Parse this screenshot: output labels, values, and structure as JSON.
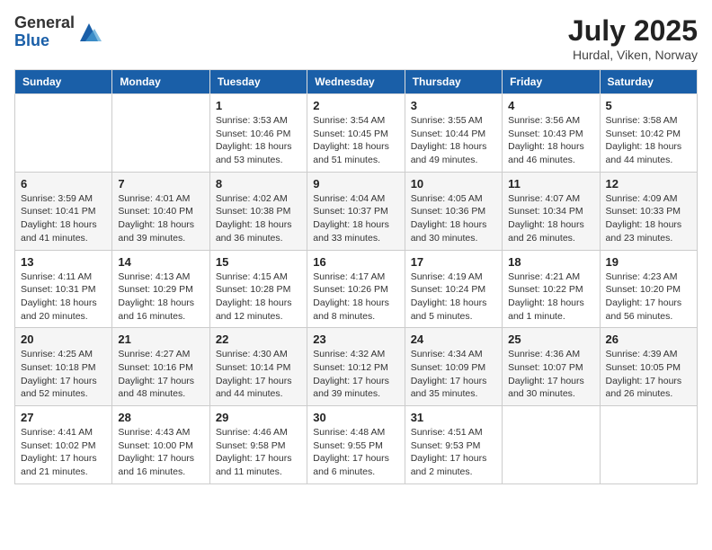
{
  "logo": {
    "general": "General",
    "blue": "Blue"
  },
  "header": {
    "month": "July 2025",
    "location": "Hurdal, Viken, Norway"
  },
  "weekdays": [
    "Sunday",
    "Monday",
    "Tuesday",
    "Wednesday",
    "Thursday",
    "Friday",
    "Saturday"
  ],
  "weeks": [
    [
      null,
      null,
      {
        "day": "1",
        "sunrise": "Sunrise: 3:53 AM",
        "sunset": "Sunset: 10:46 PM",
        "daylight": "Daylight: 18 hours and 53 minutes."
      },
      {
        "day": "2",
        "sunrise": "Sunrise: 3:54 AM",
        "sunset": "Sunset: 10:45 PM",
        "daylight": "Daylight: 18 hours and 51 minutes."
      },
      {
        "day": "3",
        "sunrise": "Sunrise: 3:55 AM",
        "sunset": "Sunset: 10:44 PM",
        "daylight": "Daylight: 18 hours and 49 minutes."
      },
      {
        "day": "4",
        "sunrise": "Sunrise: 3:56 AM",
        "sunset": "Sunset: 10:43 PM",
        "daylight": "Daylight: 18 hours and 46 minutes."
      },
      {
        "day": "5",
        "sunrise": "Sunrise: 3:58 AM",
        "sunset": "Sunset: 10:42 PM",
        "daylight": "Daylight: 18 hours and 44 minutes."
      }
    ],
    [
      {
        "day": "6",
        "sunrise": "Sunrise: 3:59 AM",
        "sunset": "Sunset: 10:41 PM",
        "daylight": "Daylight: 18 hours and 41 minutes."
      },
      {
        "day": "7",
        "sunrise": "Sunrise: 4:01 AM",
        "sunset": "Sunset: 10:40 PM",
        "daylight": "Daylight: 18 hours and 39 minutes."
      },
      {
        "day": "8",
        "sunrise": "Sunrise: 4:02 AM",
        "sunset": "Sunset: 10:38 PM",
        "daylight": "Daylight: 18 hours and 36 minutes."
      },
      {
        "day": "9",
        "sunrise": "Sunrise: 4:04 AM",
        "sunset": "Sunset: 10:37 PM",
        "daylight": "Daylight: 18 hours and 33 minutes."
      },
      {
        "day": "10",
        "sunrise": "Sunrise: 4:05 AM",
        "sunset": "Sunset: 10:36 PM",
        "daylight": "Daylight: 18 hours and 30 minutes."
      },
      {
        "day": "11",
        "sunrise": "Sunrise: 4:07 AM",
        "sunset": "Sunset: 10:34 PM",
        "daylight": "Daylight: 18 hours and 26 minutes."
      },
      {
        "day": "12",
        "sunrise": "Sunrise: 4:09 AM",
        "sunset": "Sunset: 10:33 PM",
        "daylight": "Daylight: 18 hours and 23 minutes."
      }
    ],
    [
      {
        "day": "13",
        "sunrise": "Sunrise: 4:11 AM",
        "sunset": "Sunset: 10:31 PM",
        "daylight": "Daylight: 18 hours and 20 minutes."
      },
      {
        "day": "14",
        "sunrise": "Sunrise: 4:13 AM",
        "sunset": "Sunset: 10:29 PM",
        "daylight": "Daylight: 18 hours and 16 minutes."
      },
      {
        "day": "15",
        "sunrise": "Sunrise: 4:15 AM",
        "sunset": "Sunset: 10:28 PM",
        "daylight": "Daylight: 18 hours and 12 minutes."
      },
      {
        "day": "16",
        "sunrise": "Sunrise: 4:17 AM",
        "sunset": "Sunset: 10:26 PM",
        "daylight": "Daylight: 18 hours and 8 minutes."
      },
      {
        "day": "17",
        "sunrise": "Sunrise: 4:19 AM",
        "sunset": "Sunset: 10:24 PM",
        "daylight": "Daylight: 18 hours and 5 minutes."
      },
      {
        "day": "18",
        "sunrise": "Sunrise: 4:21 AM",
        "sunset": "Sunset: 10:22 PM",
        "daylight": "Daylight: 18 hours and 1 minute."
      },
      {
        "day": "19",
        "sunrise": "Sunrise: 4:23 AM",
        "sunset": "Sunset: 10:20 PM",
        "daylight": "Daylight: 17 hours and 56 minutes."
      }
    ],
    [
      {
        "day": "20",
        "sunrise": "Sunrise: 4:25 AM",
        "sunset": "Sunset: 10:18 PM",
        "daylight": "Daylight: 17 hours and 52 minutes."
      },
      {
        "day": "21",
        "sunrise": "Sunrise: 4:27 AM",
        "sunset": "Sunset: 10:16 PM",
        "daylight": "Daylight: 17 hours and 48 minutes."
      },
      {
        "day": "22",
        "sunrise": "Sunrise: 4:30 AM",
        "sunset": "Sunset: 10:14 PM",
        "daylight": "Daylight: 17 hours and 44 minutes."
      },
      {
        "day": "23",
        "sunrise": "Sunrise: 4:32 AM",
        "sunset": "Sunset: 10:12 PM",
        "daylight": "Daylight: 17 hours and 39 minutes."
      },
      {
        "day": "24",
        "sunrise": "Sunrise: 4:34 AM",
        "sunset": "Sunset: 10:09 PM",
        "daylight": "Daylight: 17 hours and 35 minutes."
      },
      {
        "day": "25",
        "sunrise": "Sunrise: 4:36 AM",
        "sunset": "Sunset: 10:07 PM",
        "daylight": "Daylight: 17 hours and 30 minutes."
      },
      {
        "day": "26",
        "sunrise": "Sunrise: 4:39 AM",
        "sunset": "Sunset: 10:05 PM",
        "daylight": "Daylight: 17 hours and 26 minutes."
      }
    ],
    [
      {
        "day": "27",
        "sunrise": "Sunrise: 4:41 AM",
        "sunset": "Sunset: 10:02 PM",
        "daylight": "Daylight: 17 hours and 21 minutes."
      },
      {
        "day": "28",
        "sunrise": "Sunrise: 4:43 AM",
        "sunset": "Sunset: 10:00 PM",
        "daylight": "Daylight: 17 hours and 16 minutes."
      },
      {
        "day": "29",
        "sunrise": "Sunrise: 4:46 AM",
        "sunset": "Sunset: 9:58 PM",
        "daylight": "Daylight: 17 hours and 11 minutes."
      },
      {
        "day": "30",
        "sunrise": "Sunrise: 4:48 AM",
        "sunset": "Sunset: 9:55 PM",
        "daylight": "Daylight: 17 hours and 6 minutes."
      },
      {
        "day": "31",
        "sunrise": "Sunrise: 4:51 AM",
        "sunset": "Sunset: 9:53 PM",
        "daylight": "Daylight: 17 hours and 2 minutes."
      },
      null,
      null
    ]
  ]
}
